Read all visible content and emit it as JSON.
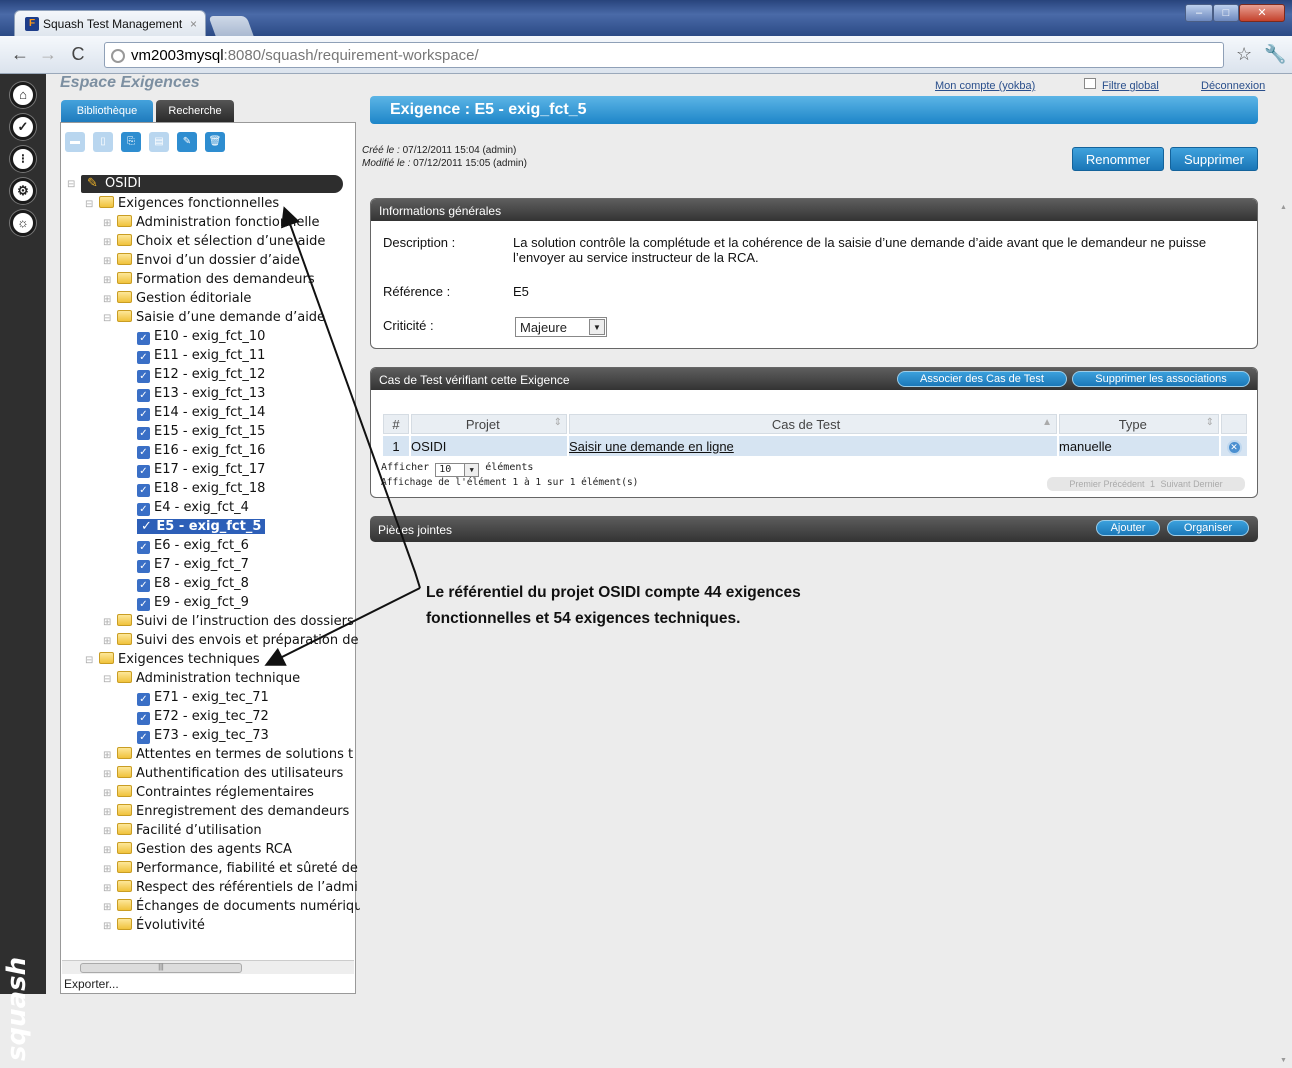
{
  "browser": {
    "tab_title": "Squash Test Management",
    "tab_favicon": "F",
    "tab_close": "×",
    "url_host": "vm2003mysql",
    "url_rest": ":8080/squash/requirement-workspace/"
  },
  "header": {
    "space_title": "Espace Exigences",
    "tabs": [
      "Bibliothèque",
      "Recherche"
    ],
    "my_account": "Mon compte (yokba)",
    "global_filter": "Filtre global",
    "logout": "Déconnexion",
    "brand": "squash"
  },
  "tree": {
    "root": "OSIDI",
    "functional": {
      "label": "Exigences fonctionnelles",
      "folders_before": [
        "Administration fonctionnelle",
        "Choix et sélection d’une aide",
        "Envoi d’un dossier d’aide",
        "Formation des demandeurs",
        "Gestion éditoriale",
        "Saisie d’une demande d’aide"
      ],
      "requirements": [
        "E10 - exig_fct_10",
        "E11 - exig_fct_11",
        "E12 - exig_fct_12",
        "E13 - exig_fct_13",
        "E14 - exig_fct_14",
        "E15 - exig_fct_15",
        "E16 - exig_fct_16",
        "E17 - exig_fct_17",
        "E18 - exig_fct_18",
        "E4 - exig_fct_4",
        "E5 - exig_fct_5",
        "E6 - exig_fct_6",
        "E7 - exig_fct_7",
        "E8 - exig_fct_8",
        "E9 - exig_fct_9"
      ],
      "selected_index": 10,
      "folders_after": [
        "Suivi de l’instruction des dossiers",
        "Suivi des envois et préparation de"
      ]
    },
    "technical": {
      "label": "Exigences techniques",
      "first_folder": "Administration technique",
      "requirements": [
        "E71 - exig_tec_71",
        "E72 - exig_tec_72",
        "E73 - exig_tec_73"
      ],
      "folders_after": [
        "Attentes en termes de solutions t",
        "Authentification des utilisateurs",
        "Contraintes réglementaires",
        "Enregistrement des demandeurs",
        "Facilité d’utilisation",
        "Gestion des agents RCA",
        "Performance, fiabilité et sûreté de",
        "Respect des référentiels de l’admi",
        "Échanges de documents numériqu",
        "Évolutivité"
      ]
    },
    "export_label": "Exporter..."
  },
  "requirement": {
    "title": "Exigence : E5 - exig_fct_5",
    "created_label": "Créé le :",
    "created_value": "07/12/2011 15:04 (admin)",
    "modified_label": "Modifié le :",
    "modified_value": "07/12/2011 15:05 (admin)",
    "rename_button": "Renommer",
    "delete_button": "Supprimer"
  },
  "general_info": {
    "header": "Informations générales",
    "description_label": "Description :",
    "description_value": "La solution contrôle la complétude et la cohérence de la saisie d’une demande d’aide avant que le demandeur ne puisse l’envoyer au service instructeur de la RCA.",
    "reference_label": "Référence :",
    "reference_value": "E5",
    "criticality_label": "Criticité :",
    "criticality_value": "Majeure"
  },
  "test_cases": {
    "header": "Cas de Test vérifiant cette Exigence",
    "associate_button": "Associer des Cas de Test",
    "remove_associations_button": "Supprimer les associations",
    "columns": [
      "#",
      "Projet",
      "Cas de Test",
      "Type"
    ],
    "rows": [
      {
        "num": "1",
        "project": "OSIDI",
        "test_case": "Saisir une demande en ligne",
        "type": "manuelle"
      }
    ],
    "show_label": "Afficher",
    "page_size": "10",
    "elements_label": "éléments",
    "info": "Affichage de l'élément 1 à 1 sur 1 élément(s)",
    "pagination": [
      "Premier",
      "Précédent",
      "1",
      "Suivant",
      "Dernier"
    ]
  },
  "attachments": {
    "header": "Pièces jointes",
    "add_button": "Ajouter",
    "organize_button": "Organiser"
  },
  "annotation": {
    "line1": "Le référentiel du projet OSIDI compte 44 exigences",
    "line2": "fonctionnelles et 54 exigences techniques."
  }
}
